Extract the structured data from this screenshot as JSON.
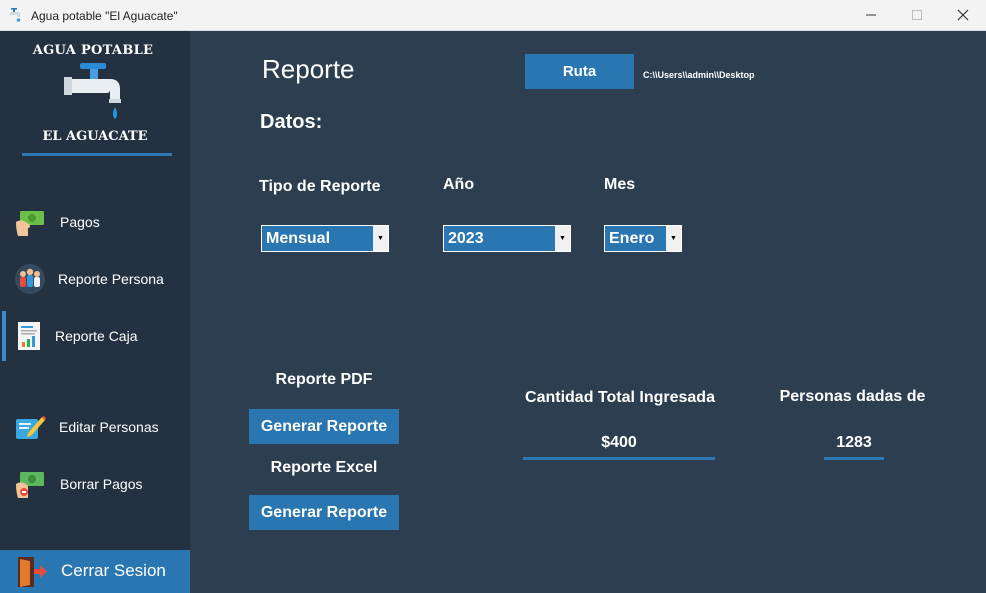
{
  "window": {
    "title": "Agua potable \"El Aguacate\"",
    "app_icon": "faucet-icon",
    "controls": {
      "minimize": "—",
      "maximize": "☐",
      "close": "✕"
    }
  },
  "sidebar": {
    "logo_top": "AGUA POTABLE",
    "logo_bottom": "EL AGUACATE",
    "items": [
      {
        "label": "Pagos",
        "icon": "money-hand-icon"
      },
      {
        "label": "Reporte Persona",
        "icon": "people-icon"
      },
      {
        "label": "Reporte Caja",
        "icon": "report-chart-icon"
      },
      {
        "label": "Editar Personas",
        "icon": "edit-pencil-icon"
      },
      {
        "label": "Borrar Pagos",
        "icon": "money-delete-icon"
      }
    ],
    "logout_label": "Cerrar Sesion"
  },
  "main": {
    "title": "Reporte",
    "route_button": "Ruta",
    "route_path": "C:\\\\Users\\\\admin\\\\Desktop",
    "datos_label": "Datos:",
    "fields": {
      "tipo_label": "Tipo  de Reporte",
      "tipo_value": "Mensual",
      "anio_label": "Año",
      "anio_value": "2023",
      "mes_label": "Mes",
      "mes_value": "Enero"
    },
    "pdf": {
      "label": "Reporte PDF",
      "button": "Generar Reporte"
    },
    "excel": {
      "label": "Reporte Excel",
      "button": "Generar Reporte"
    },
    "total": {
      "label": "Cantidad Total Ingresada",
      "value": "$400"
    },
    "personas": {
      "label": "Personas dadas de",
      "value": "1283"
    }
  },
  "colors": {
    "background": "#2c3e50",
    "sidebar": "#233140",
    "accent": "#2a76b0",
    "underline": "#2b78b5"
  }
}
